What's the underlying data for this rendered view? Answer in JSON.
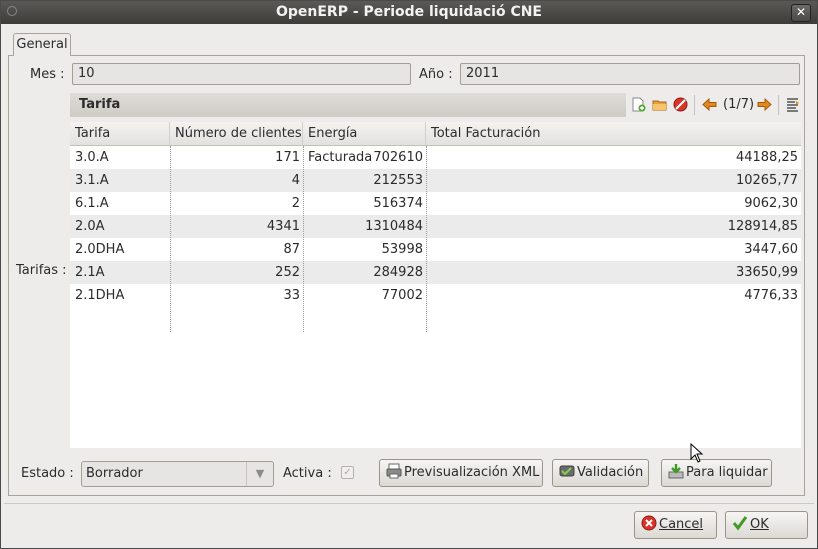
{
  "window": {
    "title": "OpenERP - Periode liquidació CNE"
  },
  "tab": {
    "label": "General"
  },
  "form": {
    "mes_label": "Mes :",
    "mes_value": "10",
    "ano_label": "Año :",
    "ano_value": "2011",
    "tarifas_label": "Tarifas :"
  },
  "tarifa_panel": {
    "title": "Tarifa",
    "pager": "(1/7)"
  },
  "table": {
    "columns": [
      "Tarifa",
      "Número de clientes",
      "Energía Facturada",
      "Total Facturación"
    ],
    "rows": [
      [
        "3.0.A",
        "171",
        "702610",
        "44188,25"
      ],
      [
        "3.1.A",
        "4",
        "212553",
        "10265,77"
      ],
      [
        "6.1.A",
        "2",
        "516374",
        "9062,30"
      ],
      [
        "2.0A",
        "4341",
        "1310484",
        "128914,85"
      ],
      [
        "2.0DHA",
        "87",
        "53998",
        "3447,60"
      ],
      [
        "2.1A",
        "252",
        "284928",
        "33650,99"
      ],
      [
        "2.1DHA",
        "33",
        "77002",
        "4776,33"
      ]
    ]
  },
  "status": {
    "estado_label": "Estado :",
    "estado_value": "Borrador",
    "activa_label": "Activa :",
    "activa_checked": true
  },
  "actions": {
    "preview_xml": "Previsualización XML",
    "validate": "Validación",
    "to_settle": "Para liquidar"
  },
  "dialog": {
    "cancel": "Cancel",
    "ok": "OK"
  },
  "colors": {
    "cancel_icon": "#d9332b",
    "ok_icon": "#3f9a26",
    "nav_arrow": "#e08a1e"
  }
}
